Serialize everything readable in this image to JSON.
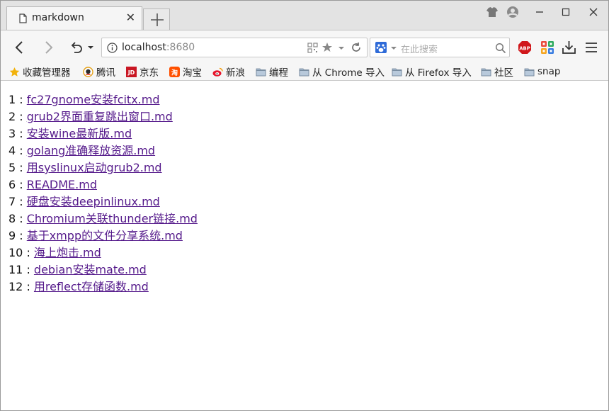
{
  "tab": {
    "title": "markdown",
    "close_glyph": "✕",
    "page_icon": "page-icon"
  },
  "newtab_icon": "plus-icon",
  "window_controls": [
    "shirt-icon",
    "account-icon",
    "minimize-icon",
    "maximize-icon",
    "close-icon"
  ],
  "nav": {
    "url_host": "localhost",
    "url_port": ":8680",
    "search_placeholder": "在此搜索"
  },
  "bookmarks": [
    {
      "label": "收藏管理器",
      "icon": "star-icon"
    },
    {
      "label": "腾讯",
      "icon": "qq-icon"
    },
    {
      "label": "京东",
      "icon": "jd-icon"
    },
    {
      "label": "淘宝",
      "icon": "taobao-icon"
    },
    {
      "label": "新浪",
      "icon": "weibo-icon"
    },
    {
      "label": "编程",
      "icon": "folder-icon"
    },
    {
      "label": "从 Chrome 导入",
      "icon": "folder-icon"
    },
    {
      "label": "从 Firefox 导入",
      "icon": "folder-icon"
    },
    {
      "label": "社区",
      "icon": "folder-icon"
    },
    {
      "label": "snap",
      "icon": "folder-icon"
    }
  ],
  "files": [
    {
      "num": "1",
      "name": "fc27gnome安装fcitx.md"
    },
    {
      "num": "2",
      "name": "grub2界面重复跳出窗口.md"
    },
    {
      "num": "3",
      "name": "安装wine最新版.md"
    },
    {
      "num": "4",
      "name": "golang准确释放资源.md"
    },
    {
      "num": "5",
      "name": "用syslinux启动grub2.md"
    },
    {
      "num": "6",
      "name": "README.md"
    },
    {
      "num": "7",
      "name": "硬盘安装deepinlinux.md"
    },
    {
      "num": "8",
      "name": "Chromium关联thunder链接.md"
    },
    {
      "num": "9",
      "name": "基于xmpp的文件分享系统.md"
    },
    {
      "num": "10",
      "name": "海上炮击.md"
    },
    {
      "num": "11",
      "name": "debian安装mate.md"
    },
    {
      "num": "12",
      "name": "用reflect存储函数.md"
    }
  ],
  "separator": " : "
}
